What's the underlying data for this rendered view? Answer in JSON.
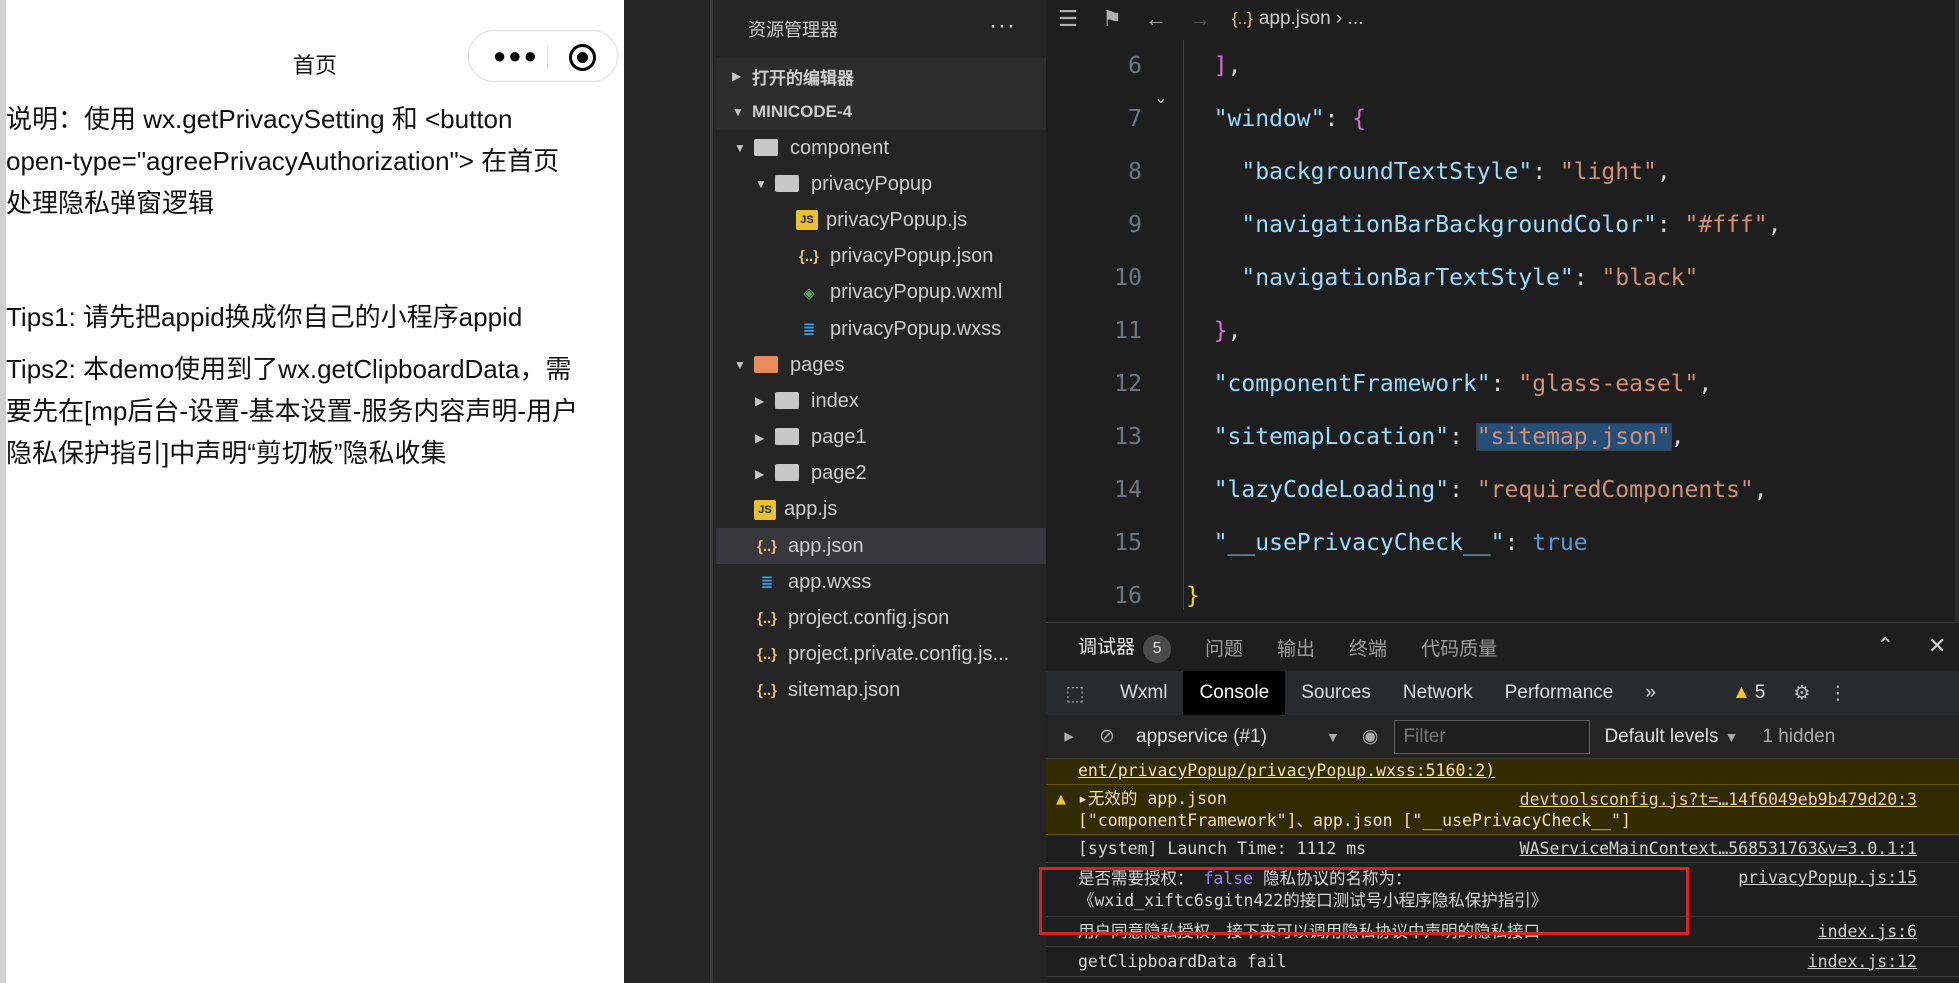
{
  "simulator": {
    "title": "首页",
    "lines": [
      "说明：使用 wx.getPrivacySetting 和 <button",
      "open-type=\"agreePrivacyAuthorization\"> 在首页",
      "处理隐私弹窗逻辑"
    ],
    "tips1": "Tips1: 请先把appid换成你自己的小程序appid",
    "tips2_lines": [
      "Tips2: 本demo使用到了wx.getClipboardData，需",
      "要先在[mp后台-设置-基本设置-服务内容声明-用户",
      "隐私保护指引]中声明“剪切板”隐私收集"
    ]
  },
  "explorer": {
    "title": "资源管理器",
    "more": "···",
    "open_editors": "打开的编辑器",
    "project": "MINICODE-4",
    "tree": [
      {
        "label": "component",
        "type": "folder-open",
        "depth": 1
      },
      {
        "label": "privacyPopup",
        "type": "folder-open",
        "depth": 2
      },
      {
        "label": "privacyPopup.js",
        "type": "js",
        "depth": 3
      },
      {
        "label": "privacyPopup.json",
        "type": "json",
        "depth": 3
      },
      {
        "label": "privacyPopup.wxml",
        "type": "wxml",
        "depth": 3
      },
      {
        "label": "privacyPopup.wxss",
        "type": "wxss",
        "depth": 3
      },
      {
        "label": "pages",
        "type": "folder-open-orange",
        "depth": 1
      },
      {
        "label": "index",
        "type": "folder",
        "depth": 2
      },
      {
        "label": "page1",
        "type": "folder",
        "depth": 2
      },
      {
        "label": "page2",
        "type": "folder",
        "depth": 2
      },
      {
        "label": "app.js",
        "type": "js",
        "depth": 1
      },
      {
        "label": "app.json",
        "type": "json",
        "depth": 1,
        "selected": true
      },
      {
        "label": "app.wxss",
        "type": "wxss",
        "depth": 1
      },
      {
        "label": "project.config.json",
        "type": "json",
        "depth": 1
      },
      {
        "label": "project.private.config.js...",
        "type": "json",
        "depth": 1
      },
      {
        "label": "sitemap.json",
        "type": "json",
        "depth": 1
      }
    ]
  },
  "editor": {
    "breadcrumb_file": "app.json",
    "breadcrumb_more": "...",
    "line_numbers": [
      "6",
      "7",
      "8",
      "9",
      "10",
      "11",
      "12",
      "13",
      "14",
      "15",
      "16"
    ]
  },
  "debugger": {
    "tabs": [
      "调试器",
      "问题",
      "输出",
      "终端",
      "代码质量"
    ],
    "badge": "5",
    "devtools_tabs": [
      "Wxml",
      "Console",
      "Sources",
      "Network",
      "Performance"
    ],
    "warn_count": "5",
    "context": "appservice (#1)",
    "filter_placeholder": "Filter",
    "levels": "Default levels",
    "hidden": "1 hidden",
    "messages": [
      {
        "text": "ent/privacyPopup/privacyPopup.wxss:5160:2)",
        "kind": "warn"
      },
      {
        "text": "▸无效的 app.json",
        "text2": "[\"componentFramework\"]、app.json [\"__usePrivacyCheck__\"]",
        "src": "devtoolsconfig.js?t=…14f6049eb9b479d20:3",
        "kind": "warn"
      },
      {
        "text": "[system] Launch Time: 1112 ms",
        "src": "WAServiceMainContext…568531763&v=3.0.1:1",
        "kind": "log"
      },
      {
        "text": "是否需要授权： ",
        "bool": "false",
        "text_b": " 隐私协议的名称为：",
        "text2": "《wxid_xiftc6sgitn422的接口测试号小程序隐私保护指引》",
        "src": "privacyPopup.js:15",
        "kind": "log"
      },
      {
        "text": "用户同意隐私授权，接下来可以调用隐私协议中声明的隐私接口",
        "src": "index.js:6",
        "kind": "log"
      },
      {
        "text": "getClipboardData fail",
        "src": "index.js:12",
        "kind": "log"
      }
    ]
  },
  "colors": {
    "accent": "#007acc",
    "highlight_box": "#e02020",
    "warning": "#f6c026"
  }
}
